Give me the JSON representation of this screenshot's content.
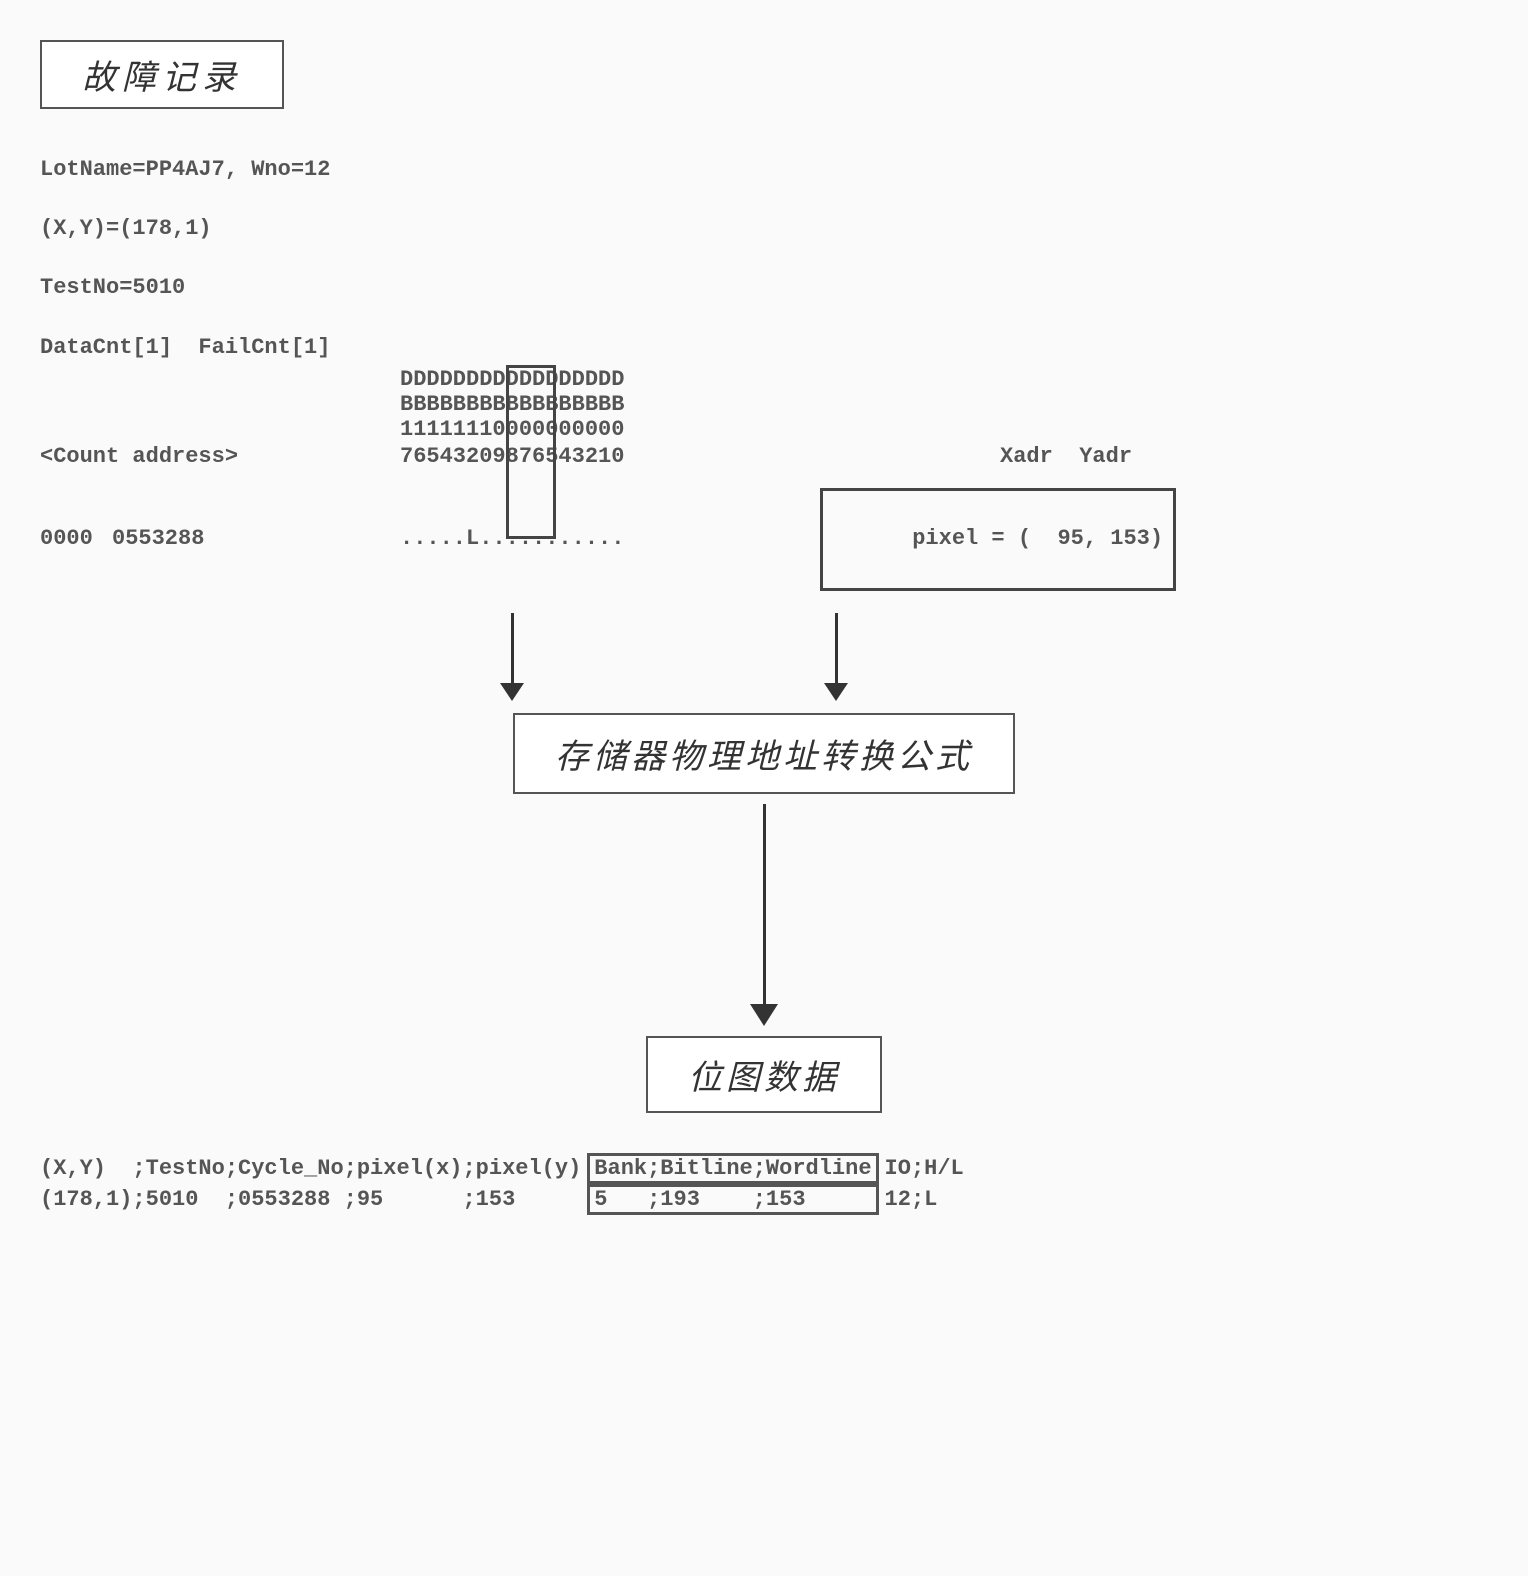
{
  "title": "故障记录",
  "info": {
    "lot_line": "LotName=PP4AJ7, Wno=12",
    "xy_line": "(X,Y)=(178,1)",
    "testno_line": "TestNo=5010",
    "cnt_line": "DataCnt[1]  FailCnt[1]"
  },
  "headers": {
    "l1": "DDDDDDDDDDDDDDDDD",
    "l2": "BBBBBBBBBBBBBBBBB",
    "l3": "11111110000000000",
    "l4": "76543209876543210",
    "count_addr_label": "<Count address>",
    "xy_label": "Xadr  Yadr"
  },
  "data_row": {
    "count": "0000",
    "address": "0553288",
    "bits": ".....L...........",
    "pixel": "pixel = (  95, 153)"
  },
  "formula_label": "存储器物理地址转换公式",
  "bitmap_label": "位图数据",
  "final": {
    "header_left": "(X,Y)  ;TestNo;Cycle_No;pixel(x);pixel(y)",
    "header_mid": "Bank;Bitline;Wordline",
    "header_right": "IO;H/L",
    "row_left": "(178,1);5010  ;0553288 ;95      ;153     ",
    "row_mid": "5   ;193    ;153     ",
    "row_right": "12;L"
  }
}
